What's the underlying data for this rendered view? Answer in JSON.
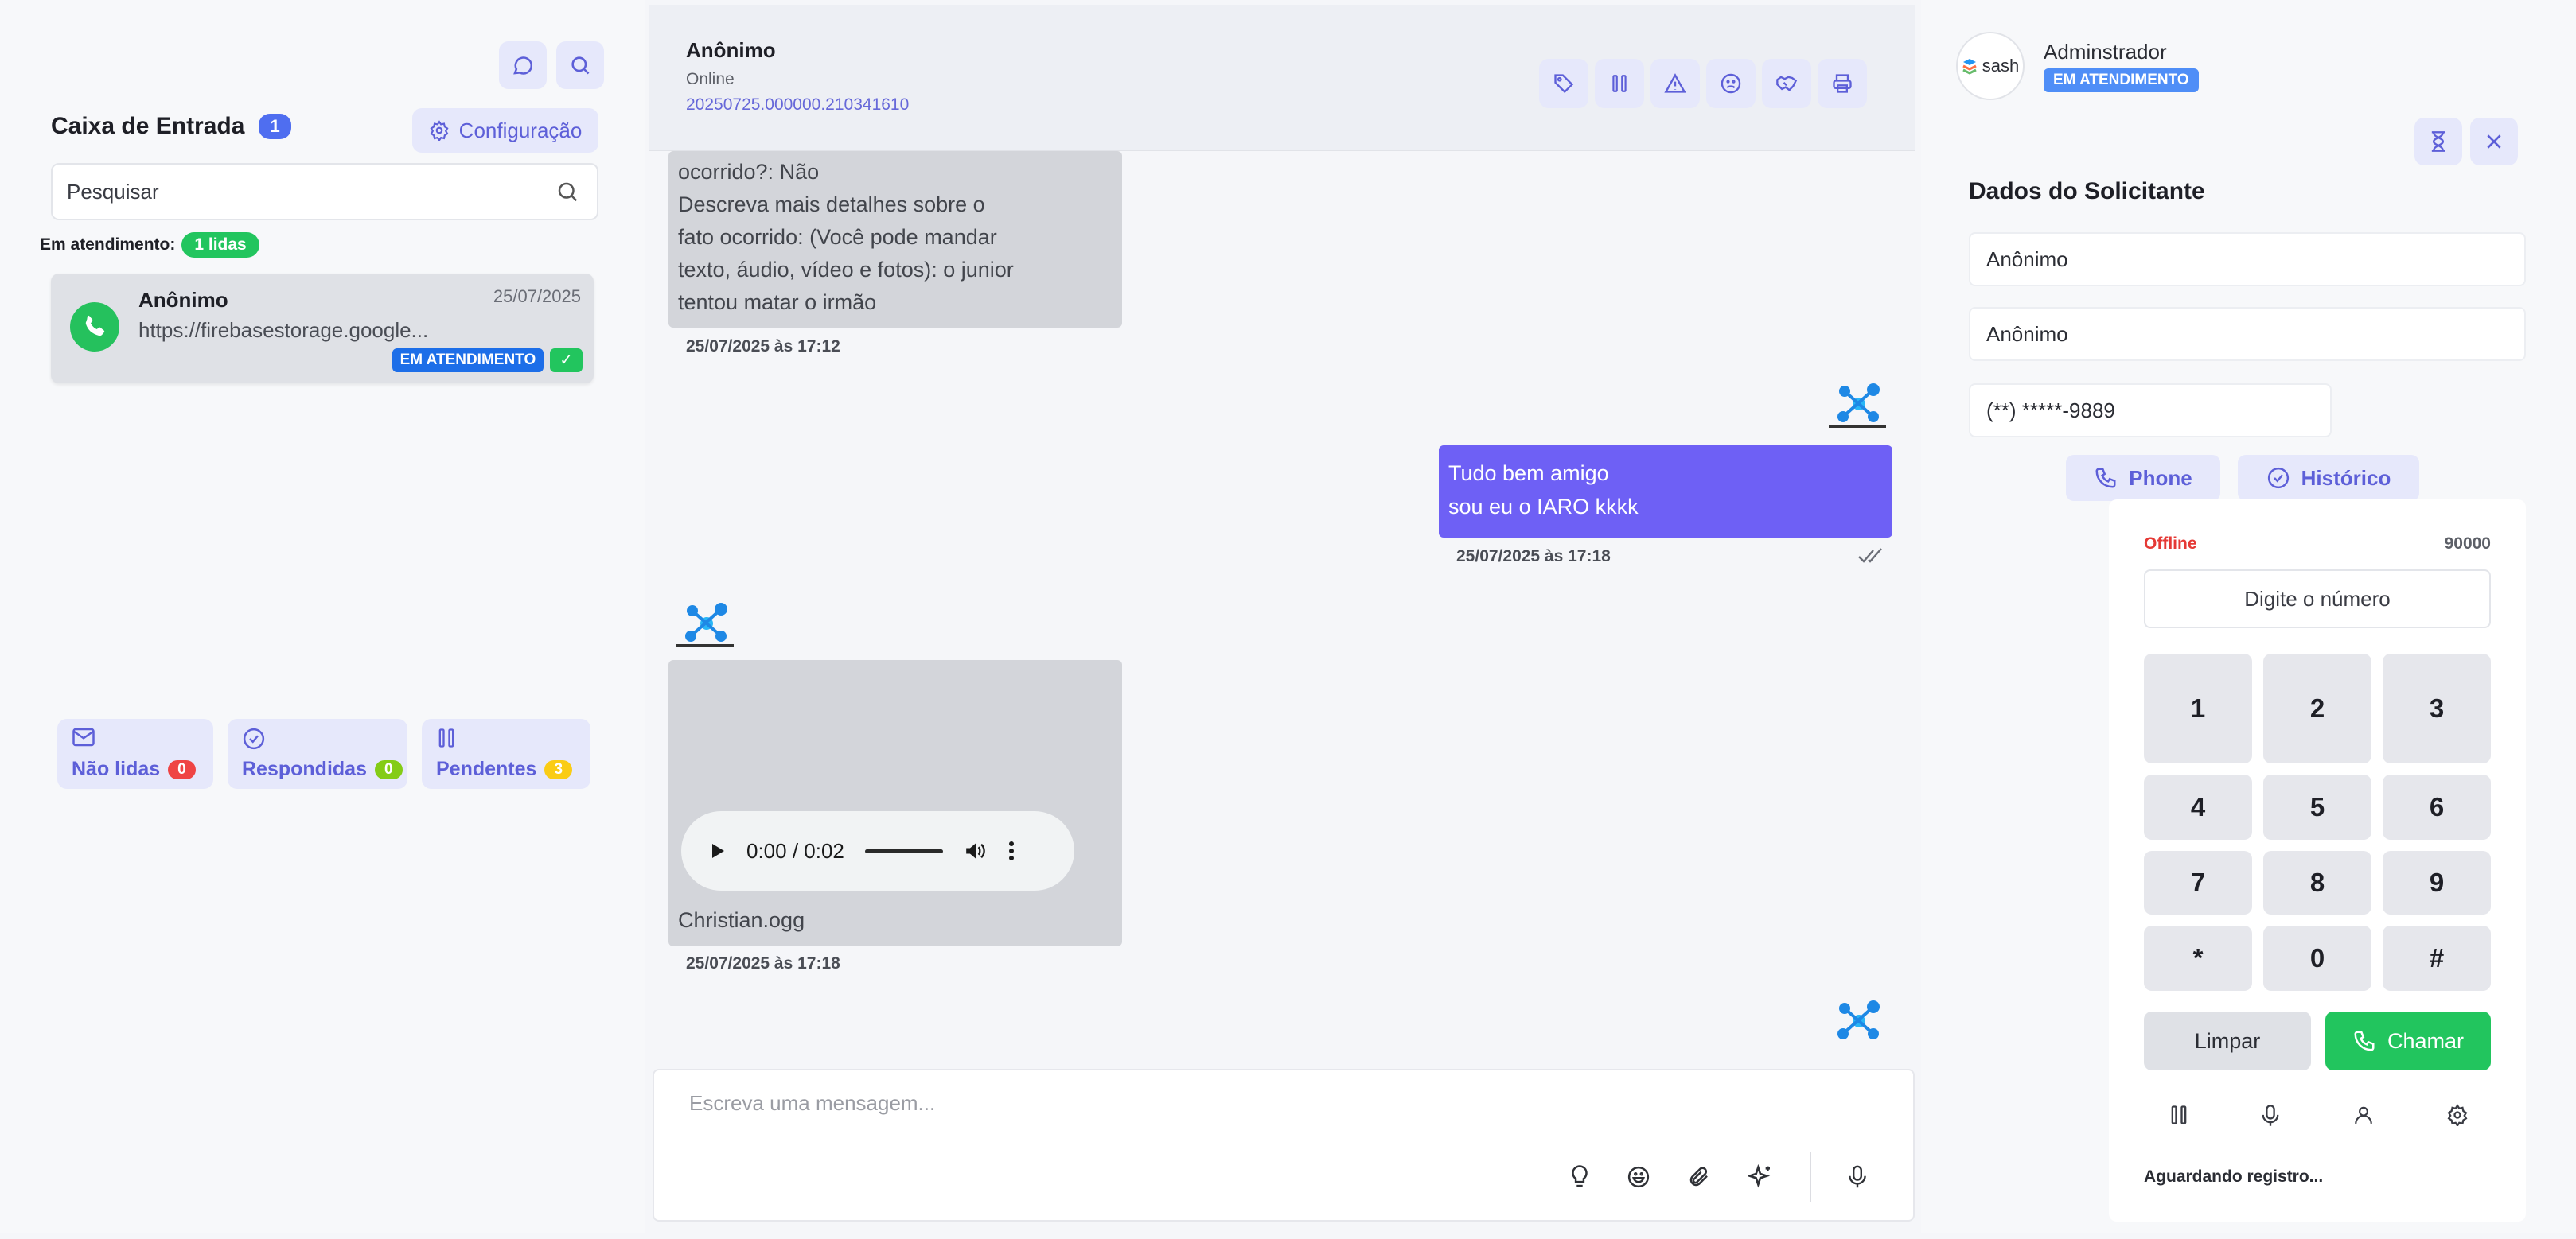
{
  "sidebar": {
    "inbox_title": "Caixa de Entrada",
    "inbox_count": "1",
    "config_label": "Configuração",
    "search_placeholder": "Pesquisar",
    "in_service_label": "Em atendimento:",
    "in_service_badge": "1 lidas",
    "conversations": [
      {
        "name": "Anônimo",
        "date": "25/07/2025",
        "preview": "https://firebasestorage.google...",
        "status": "EM ATENDIMENTO",
        "check": "✓"
      }
    ],
    "filters": [
      {
        "label": "Não lidas",
        "count": "0",
        "color": "#ef4444"
      },
      {
        "label": "Respondidas",
        "count": "0",
        "color": "#84cc16"
      },
      {
        "label": "Pendentes",
        "count": "3",
        "color": "#facc15"
      }
    ]
  },
  "chat": {
    "contact_name": "Anônimo",
    "contact_status": "Online",
    "protocol": "20250725.000000.210341610",
    "messages": [
      {
        "direction": "in",
        "lines": [
          "ocorrido?: Não",
          "Descreva mais detalhes sobre o",
          "fato ocorrido: (Você pode mandar",
          "texto, áudio, vídeo e fotos): o junior",
          "tentou matar o irmão"
        ],
        "timestamp": "25/07/2025 às 17:12"
      },
      {
        "direction": "out",
        "lines": [
          "Tudo bem amigo",
          "sou eu o IARO kkkk"
        ],
        "timestamp": "25/07/2025 às 17:18"
      },
      {
        "direction": "in",
        "audio_time": "0:00 / 0:02",
        "filename": "Christian.ogg",
        "timestamp": "25/07/2025 às 17:18"
      }
    ],
    "composer_placeholder": "Escreva uma mensagem..."
  },
  "requester": {
    "user_name": "Adminstrador",
    "user_badge": "EM ATENDIMENTO",
    "logo_text": "sash",
    "title": "Dados do Solicitante",
    "field_name": "Anônimo",
    "field_name2": "Anônimo",
    "field_phone": "(**) *****-9889",
    "phone_button": "Phone",
    "history_button": "Histórico"
  },
  "dialer": {
    "status": "Offline",
    "extension": "90000",
    "number_placeholder": "Digite o número",
    "keys": [
      "1",
      "2",
      "3",
      "4",
      "5",
      "6",
      "7",
      "8",
      "9",
      "*",
      "0",
      "#"
    ],
    "clear_label": "Limpar",
    "call_label": "Chamar",
    "register_status": "Aguardando registro..."
  },
  "colors": {
    "accent": "#6e60f5",
    "accent_soft": "#e6e8fb",
    "success": "#22c55e",
    "danger": "#e53935",
    "badge_blue": "#4f6ef0"
  }
}
